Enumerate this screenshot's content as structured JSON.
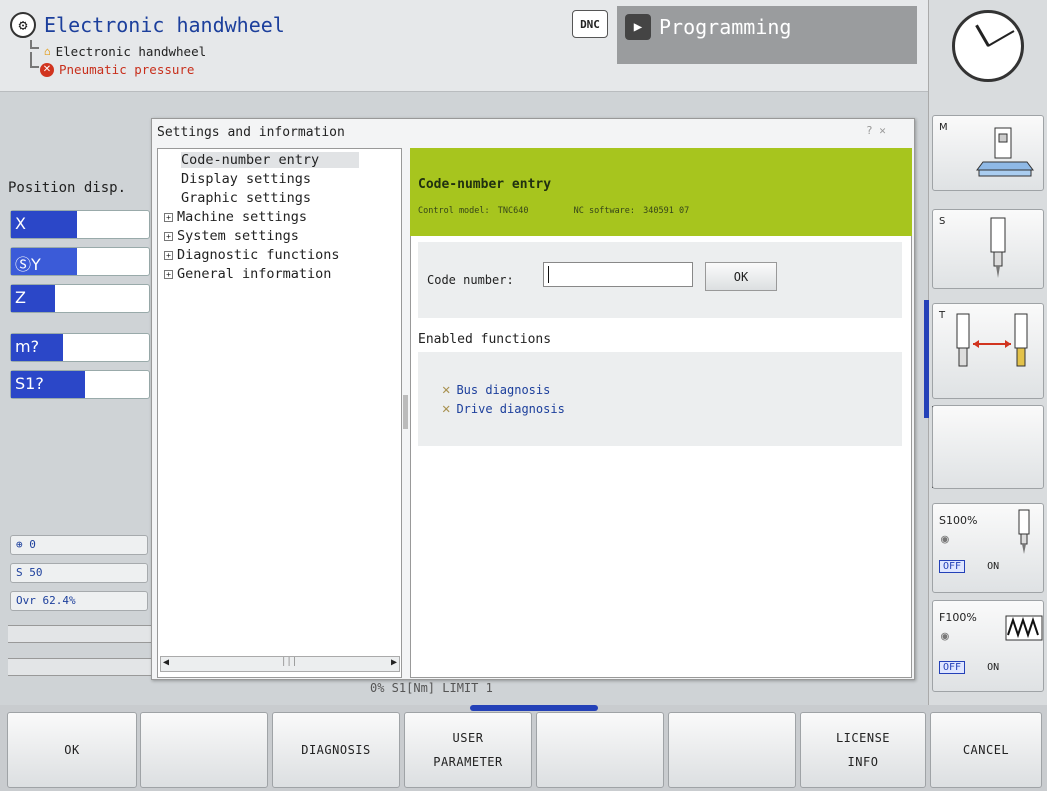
{
  "header": {
    "op_mode_title": "Electronic handwheel",
    "sub_mode": "Electronic handwheel",
    "error_message": "Pneumatic pressure",
    "dnc_badge": "DNC",
    "prog_mode_title": "Programming"
  },
  "position_display": {
    "title": "Position disp.",
    "axes": [
      {
        "label": "X"
      },
      {
        "label": "ⓈY"
      },
      {
        "label": "Z"
      },
      {
        "label": "m?"
      },
      {
        "label": "S1?"
      }
    ],
    "status_fields": [
      "⊕ 0",
      "S 50",
      "Ovr 62.4%"
    ],
    "background_text": "0% S1[Nm]   LIMIT 1"
  },
  "dialog": {
    "title": "Settings and information",
    "title_icons": "? ✕",
    "tree": [
      {
        "label": "Code-number entry",
        "expandable": false,
        "selected": true
      },
      {
        "label": "Display settings",
        "expandable": false,
        "selected": false
      },
      {
        "label": "Graphic settings",
        "expandable": false,
        "selected": false
      },
      {
        "label": "Machine settings",
        "expandable": true,
        "selected": false
      },
      {
        "label": "System settings",
        "expandable": true,
        "selected": false
      },
      {
        "label": "Diagnostic functions",
        "expandable": true,
        "selected": false
      },
      {
        "label": "General information",
        "expandable": true,
        "selected": false
      }
    ],
    "content": {
      "heading": "Code-number entry",
      "control_model_label": "Control model:",
      "control_model": "TNC640",
      "nc_software_label": "NC software:",
      "nc_software": "340591 07",
      "code_number_label": "Code number:",
      "code_number_value": "",
      "ok_button": "OK",
      "enabled_functions_title": "Enabled functions",
      "enabled_functions": [
        "Bus diagnosis",
        "Drive diagnosis"
      ]
    }
  },
  "right_softkeys": {
    "m_label": "M",
    "s_label": "S",
    "t_label": "T",
    "spindle_override": "S100%",
    "feed_override": "F100%",
    "off_label": "OFF",
    "on_label": "ON"
  },
  "bottom_softkeys": [
    {
      "line1": "OK",
      "line2": ""
    },
    {
      "line1": "",
      "line2": ""
    },
    {
      "line1": "DIAGNOSIS",
      "line2": ""
    },
    {
      "line1": "USER",
      "line2": "PARAMETER"
    },
    {
      "line1": "",
      "line2": ""
    },
    {
      "line1": "",
      "line2": ""
    },
    {
      "line1": "LICENSE",
      "line2": "INFO"
    },
    {
      "line1": "CANCEL",
      "line2": ""
    }
  ],
  "colors": {
    "accent_blue": "#2b47c8",
    "header_green": "#a7c51e",
    "error_red": "#d1341f"
  }
}
